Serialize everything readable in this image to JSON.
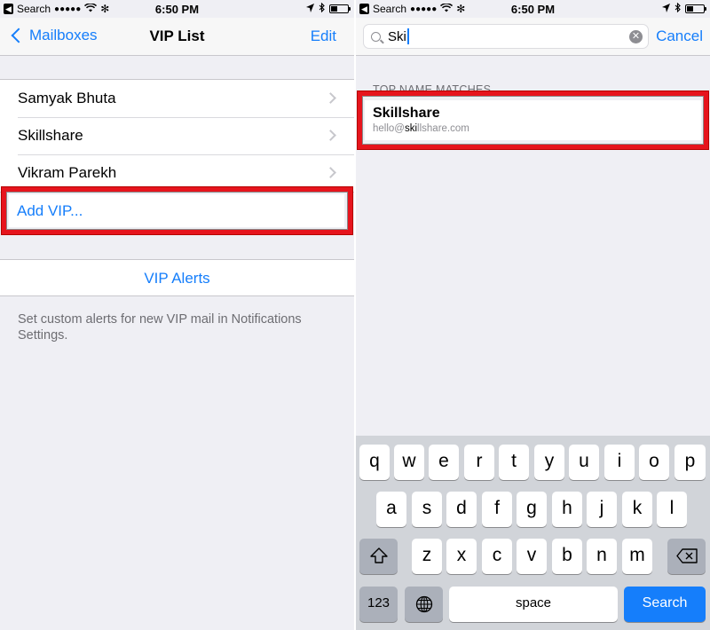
{
  "status_bar": {
    "back_label": "Search",
    "signal": "●●●●●",
    "time": "6:50 PM"
  },
  "left": {
    "nav": {
      "back_label": "Mailboxes",
      "title": "VIP List",
      "edit_label": "Edit"
    },
    "vips": [
      "Samyak Bhuta",
      "Skillshare",
      "Vikram Parekh"
    ],
    "add_vip_label": "Add VIP...",
    "alerts_label": "VIP Alerts",
    "footer_note": "Set custom alerts for new VIP mail in Notifications Settings."
  },
  "right": {
    "search": {
      "query": "Ski",
      "cancel_label": "Cancel"
    },
    "section_title": "TOP NAME MATCHES",
    "match": {
      "name": "Skillshare",
      "email_prefix": "hello@",
      "email_match": "ski",
      "email_suffix": "llshare.com"
    }
  },
  "keyboard": {
    "row1": [
      "q",
      "w",
      "e",
      "r",
      "t",
      "y",
      "u",
      "i",
      "o",
      "p"
    ],
    "row2": [
      "a",
      "s",
      "d",
      "f",
      "g",
      "h",
      "j",
      "k",
      "l"
    ],
    "row3": [
      "z",
      "x",
      "c",
      "v",
      "b",
      "n",
      "m"
    ],
    "numbers_label": "123",
    "space_label": "space",
    "search_label": "Search"
  },
  "colors": {
    "accent": "#157efb",
    "highlight": "#e6141d",
    "background": "#efeff4",
    "keyboard": "#d1d4d9"
  }
}
